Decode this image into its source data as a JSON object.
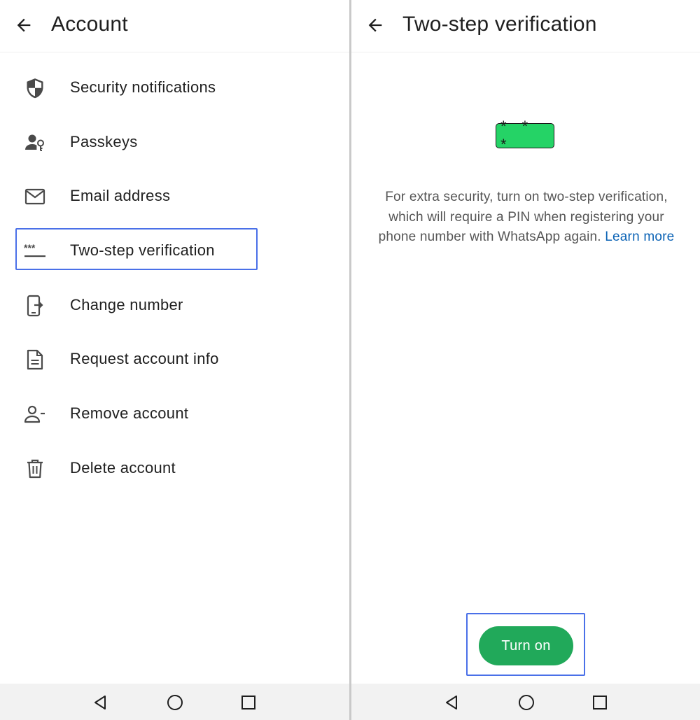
{
  "left_screen": {
    "title": "Account",
    "menu_items": [
      {
        "label": "Security notifications",
        "icon": "shield-icon"
      },
      {
        "label": "Passkeys",
        "icon": "person-key-icon"
      },
      {
        "label": "Email address",
        "icon": "mail-icon"
      },
      {
        "label": "Two-step verification",
        "icon": "password-icon",
        "highlighted": true
      },
      {
        "label": "Change number",
        "icon": "phone-transfer-icon"
      },
      {
        "label": "Request account info",
        "icon": "document-icon"
      },
      {
        "label": "Remove account",
        "icon": "person-remove-icon"
      },
      {
        "label": "Delete account",
        "icon": "trash-icon"
      }
    ]
  },
  "right_screen": {
    "title": "Two-step verification",
    "pin_graphic": "* * *",
    "description": "For extra security, turn on two-step verification, which will require a PIN when registering your phone number with WhatsApp again.",
    "learn_more": "Learn more",
    "turn_on_label": "Turn on"
  },
  "colors": {
    "highlight": "#4a70e8",
    "accent_green": "#21a95a",
    "pin_green": "#25d366",
    "link_blue": "#0a62b5"
  }
}
